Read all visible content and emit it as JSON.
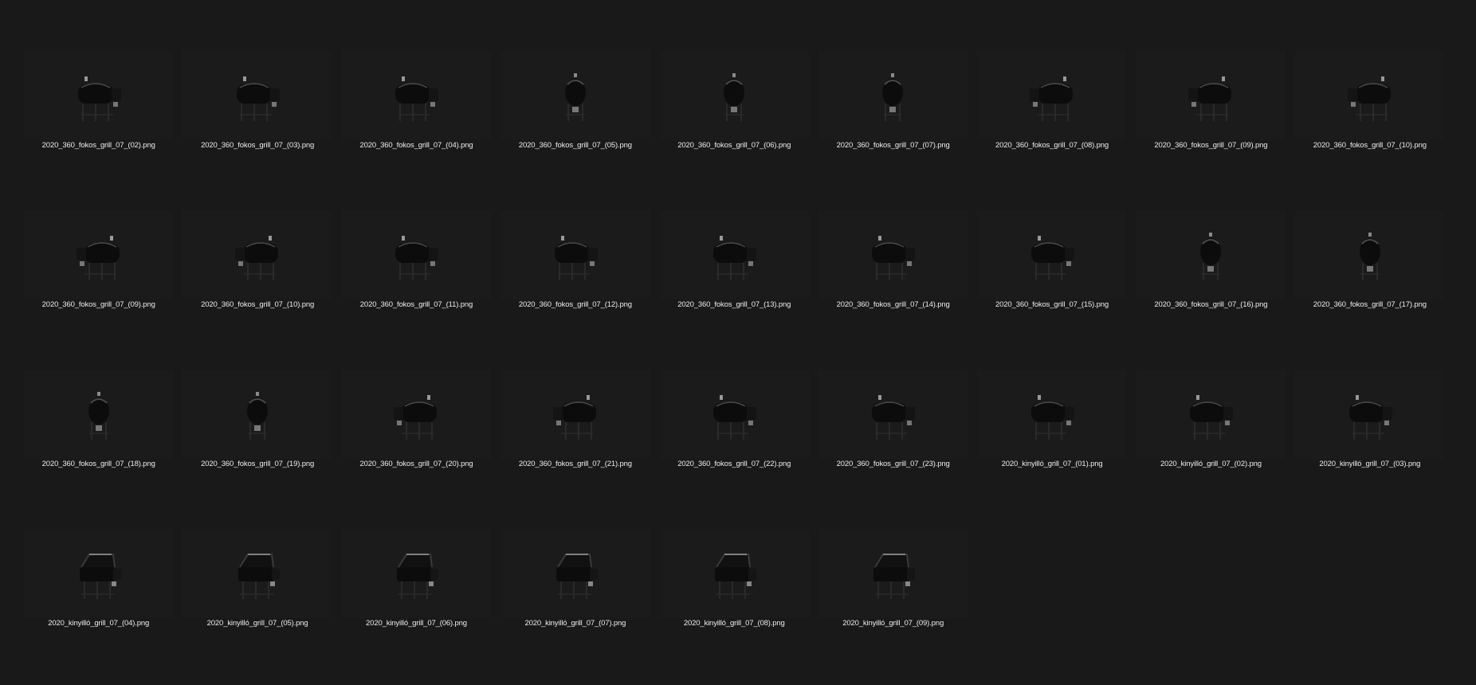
{
  "files": [
    {
      "name": "2020_360_fokos_grill_07_(02).png",
      "view": "side-left"
    },
    {
      "name": "2020_360_fokos_grill_07_(03).png",
      "view": "angle-left"
    },
    {
      "name": "2020_360_fokos_grill_07_(04).png",
      "view": "angle-left"
    },
    {
      "name": "2020_360_fokos_grill_07_(05).png",
      "view": "end"
    },
    {
      "name": "2020_360_fokos_grill_07_(06).png",
      "view": "end"
    },
    {
      "name": "2020_360_fokos_grill_07_(07).png",
      "view": "end"
    },
    {
      "name": "2020_360_fokos_grill_07_(08).png",
      "view": "angle-right"
    },
    {
      "name": "2020_360_fokos_grill_07_(09).png",
      "view": "angle-right"
    },
    {
      "name": "2020_360_fokos_grill_07_(10).png",
      "view": "side-right"
    },
    {
      "name": "2020_360_fokos_grill_07_(09).png",
      "view": "side-right"
    },
    {
      "name": "2020_360_fokos_grill_07_(10).png",
      "view": "side-right"
    },
    {
      "name": "2020_360_fokos_grill_07_(11).png",
      "view": "front"
    },
    {
      "name": "2020_360_fokos_grill_07_(12).png",
      "view": "front"
    },
    {
      "name": "2020_360_fokos_grill_07_(13).png",
      "view": "front"
    },
    {
      "name": "2020_360_fokos_grill_07_(14).png",
      "view": "angle-left"
    },
    {
      "name": "2020_360_fokos_grill_07_(15).png",
      "view": "angle-left"
    },
    {
      "name": "2020_360_fokos_grill_07_(16).png",
      "view": "end"
    },
    {
      "name": "2020_360_fokos_grill_07_(17).png",
      "view": "end"
    },
    {
      "name": "2020_360_fokos_grill_07_(18).png",
      "view": "end"
    },
    {
      "name": "2020_360_fokos_grill_07_(19).png",
      "view": "end"
    },
    {
      "name": "2020_360_fokos_grill_07_(20).png",
      "view": "angle-right"
    },
    {
      "name": "2020_360_fokos_grill_07_(21).png",
      "view": "angle-right"
    },
    {
      "name": "2020_360_fokos_grill_07_(22).png",
      "view": "front"
    },
    {
      "name": "2020_360_fokos_grill_07_(23).png",
      "view": "front"
    },
    {
      "name": "2020_kinyilló_grill_07_(01).png",
      "view": "front"
    },
    {
      "name": "2020_kinyilló_grill_07_(02).png",
      "view": "front"
    },
    {
      "name": "2020_kinyilló_grill_07_(03).png",
      "view": "front"
    },
    {
      "name": "2020_kinyilló_grill_07_(04).png",
      "view": "open"
    },
    {
      "name": "2020_kinyilló_grill_07_(05).png",
      "view": "open"
    },
    {
      "name": "2020_kinyilló_grill_07_(06).png",
      "view": "open"
    },
    {
      "name": "2020_kinyilló_grill_07_(07).png",
      "view": "open"
    },
    {
      "name": "2020_kinyilló_grill_07_(08).png",
      "view": "open"
    },
    {
      "name": "2020_kinyilló_grill_07_(09).png",
      "view": "open"
    }
  ],
  "colors": {
    "background": "#191919",
    "tile": "#1b1b1b",
    "label": "#ececec",
    "grill_body": "#0c0c0c",
    "grill_highlight": "#4a4a4a"
  },
  "icons": {
    "thumbnail": "grill-icon"
  }
}
